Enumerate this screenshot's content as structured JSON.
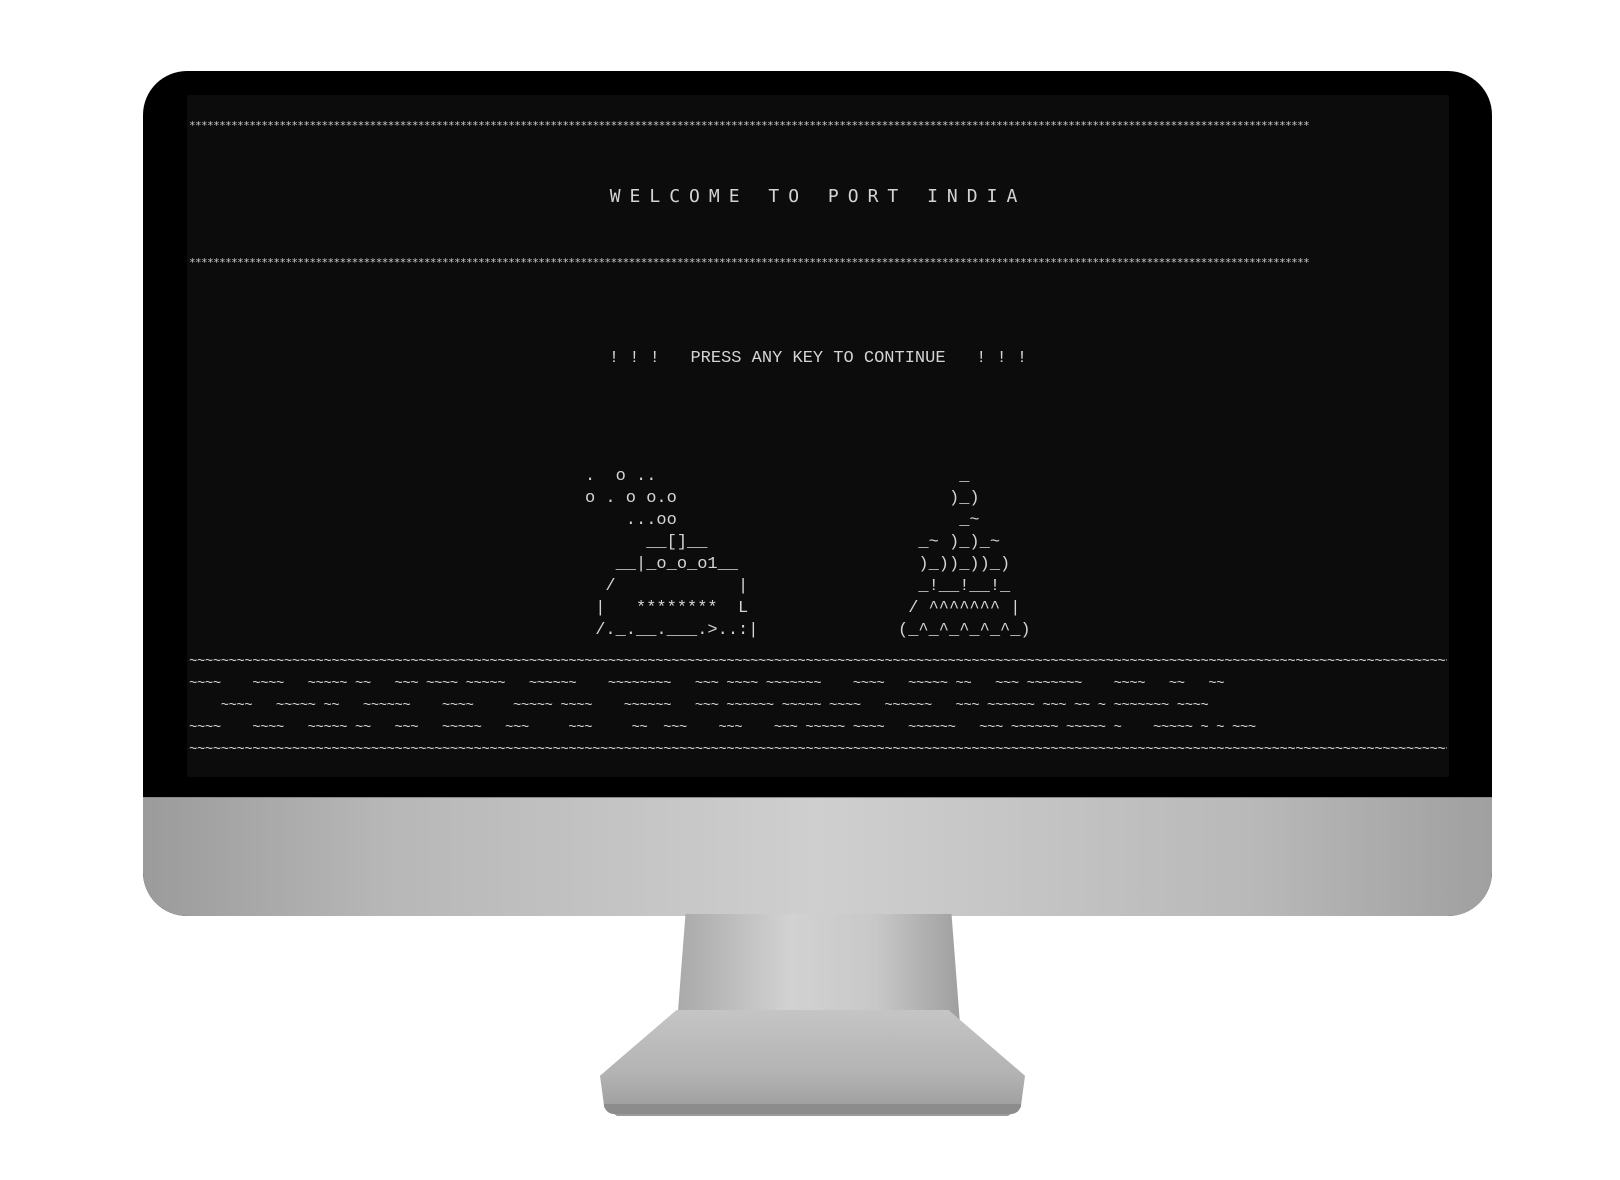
{
  "screen": {
    "stars_line": "******************************************************************************************************************************************************************************************",
    "welcome_text": "WELCOME TO PORT INDIA",
    "prompt_text": "! ! !   PRESS ANY KEY TO CONTINUE   ! ! !",
    "ship_art": ".  o ..\no . o o.o\n    ...oo\n      __[]__\n   __|_o_o_o1__\n  /            |\n |   ********  L\n /._.__.___.>..:|",
    "temple_art": "      _\n     )_)\n      _~\n  _~ )_)_~\n  )_))_))_)\n  _!__!__!_\n / ^^^^^^^ |\n(_^_^_^_^_^_)",
    "sea_art": "~~~~~~~~~~~~~~~~~~~~~~~~~~~~~~~~~~~~~~~~~~~~~~~~~~~~~~~~~~~~~~~~~~~~~~~~~~~~~~~~~~~~~~~~~~~~~~~~~~~~~~~~~~~~~~~~~~~~~~~~~~~~~~~~~~~~~~~~~~~~~~~~~~~~~~~~~~~~~~~~~~~~~~~~~~~~~~~\n~~~~    ~~~~   ~~~~~ ~~   ~~~ ~~~~ ~~~~~   ~~~~~~    ~~~~~~~~   ~~~ ~~~~ ~~~~~~~    ~~~~   ~~~~~ ~~   ~~~ ~~~~~~~    ~~~~   ~~   ~~\n    ~~~~   ~~~~~ ~~   ~~~~~~    ~~~~     ~~~~~ ~~~~    ~~~~~~   ~~~ ~~~~~~ ~~~~~ ~~~~   ~~~~~~   ~~~ ~~~~~~ ~~~ ~~ ~ ~~~~~~~ ~~~~\n~~~~    ~~~~   ~~~~~ ~~   ~~~   ~~~~~   ~~~     ~~~     ~~  ~~~    ~~~    ~~~ ~~~~~ ~~~~   ~~~~~~   ~~~ ~~~~~~ ~~~~~ ~    ~~~~~ ~ ~ ~~~\n~~~~~~~~~~~~~~~~~~~~~~~~~~~~~~~~~~~~~~~~~~~~~~~~~~~~~~~~~~~~~~~~~~~~~~~~~~~~~~~~~~~~~~~~~~~~~~~~~~~~~~~~~~~~~~~~~~~~~~~~~~~~~~~~~~~~~~~~~~~~~~~~~~~~~~~~~~~~~~~~~~~~~~~~~~~~~~~"
  },
  "colors": {
    "screen_bg": "#0c0c0c",
    "text": "#d4d4d4",
    "bezel": "#000000",
    "chassis": "#c0c0c0"
  }
}
